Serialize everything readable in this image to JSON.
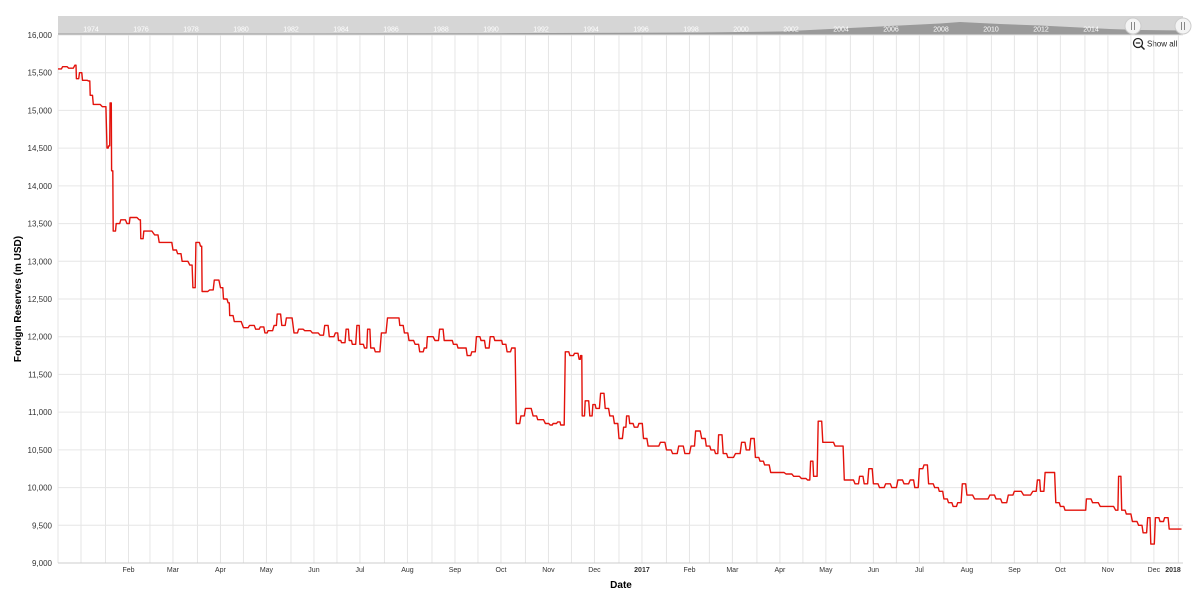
{
  "navigator": {
    "years": [
      "1974",
      "1976",
      "1978",
      "1980",
      "1982",
      "1984",
      "1986",
      "1988",
      "1990",
      "1992",
      "1994",
      "1996",
      "1998",
      "2000",
      "2002",
      "2004",
      "2006",
      "2008",
      "2010",
      "2012",
      "2014"
    ]
  },
  "zoom": {
    "show_all_label": "Show all"
  },
  "colors": {
    "series": "#e3120b",
    "grid": "#e6e6e6",
    "navigator_bg": "#d6d6d6",
    "navigator_area": "#9a9a9a"
  },
  "chart_data": {
    "type": "line",
    "title": "",
    "xlabel": "Date",
    "ylabel": "Foreign Reserves (m USD)",
    "ylim": [
      9000,
      16000
    ],
    "y_ticks": [
      9000,
      9500,
      10000,
      10500,
      11000,
      11500,
      12000,
      12500,
      13000,
      13500,
      14000,
      14500,
      15000,
      15500,
      16000
    ],
    "y_tick_labels": [
      "9,000",
      "9,500",
      "10,000",
      "10,500",
      "11,000",
      "11,500",
      "12,000",
      "12,500",
      "13,000",
      "13,500",
      "14,000",
      "14,500",
      "15,000",
      "15,500",
      "16,000"
    ],
    "xlim": [
      "2016-01-01",
      "2018-01-04"
    ],
    "x_ticks": [
      {
        "date": "2016-02-01",
        "label": "Feb"
      },
      {
        "date": "2016-03-01",
        "label": "Mar"
      },
      {
        "date": "2016-04-01",
        "label": "Apr"
      },
      {
        "date": "2016-05-01",
        "label": "May"
      },
      {
        "date": "2016-06-01",
        "label": "Jun"
      },
      {
        "date": "2016-07-01",
        "label": "Jul"
      },
      {
        "date": "2016-08-01",
        "label": "Aug"
      },
      {
        "date": "2016-09-01",
        "label": "Sep"
      },
      {
        "date": "2016-10-01",
        "label": "Oct"
      },
      {
        "date": "2016-11-01",
        "label": "Nov"
      },
      {
        "date": "2016-12-01",
        "label": "Dec"
      },
      {
        "date": "2017-01-01",
        "label": "2017",
        "bold": true
      },
      {
        "date": "2017-02-01",
        "label": "Feb"
      },
      {
        "date": "2017-03-01",
        "label": "Mar"
      },
      {
        "date": "2017-04-01",
        "label": "Apr"
      },
      {
        "date": "2017-05-01",
        "label": "May"
      },
      {
        "date": "2017-06-01",
        "label": "Jun"
      },
      {
        "date": "2017-07-01",
        "label": "Jul"
      },
      {
        "date": "2017-08-01",
        "label": "Aug"
      },
      {
        "date": "2017-09-01",
        "label": "Sep"
      },
      {
        "date": "2017-10-01",
        "label": "Oct"
      },
      {
        "date": "2017-11-01",
        "label": "Nov"
      },
      {
        "date": "2017-12-01",
        "label": "Dec"
      },
      {
        "date": "2018-01-01",
        "label": "2018",
        "bold": true
      }
    ],
    "series": [
      {
        "points": [
          [
            "2016-01-01",
            15550
          ],
          [
            "2016-01-04",
            15580
          ],
          [
            "2016-01-08",
            15560
          ],
          [
            "2016-01-12",
            15600
          ],
          [
            "2016-01-13",
            15420
          ],
          [
            "2016-01-15",
            15500
          ],
          [
            "2016-01-17",
            15400
          ],
          [
            "2016-01-21",
            15390
          ],
          [
            "2016-01-22",
            15200
          ],
          [
            "2016-01-24",
            15080
          ],
          [
            "2016-01-30",
            15050
          ],
          [
            "2016-02-02",
            14500
          ],
          [
            "2016-02-03",
            14530
          ],
          [
            "2016-02-04",
            15100
          ],
          [
            "2016-02-05",
            14200
          ],
          [
            "2016-02-06",
            13400
          ],
          [
            "2016-02-08",
            13500
          ],
          [
            "2016-02-11",
            13550
          ],
          [
            "2016-02-15",
            13500
          ],
          [
            "2016-02-17",
            13580
          ],
          [
            "2016-02-23",
            13550
          ],
          [
            "2016-02-24",
            13300
          ],
          [
            "2016-02-26",
            13400
          ],
          [
            "2016-03-04",
            13350
          ],
          [
            "2016-03-07",
            13250
          ],
          [
            "2016-03-13",
            13250
          ],
          [
            "2016-03-16",
            13150
          ],
          [
            "2016-03-19",
            13100
          ],
          [
            "2016-03-22",
            13000
          ],
          [
            "2016-03-27",
            12950
          ],
          [
            "2016-03-29",
            12650
          ],
          [
            "2016-03-31",
            13250
          ],
          [
            "2016-04-03",
            13200
          ],
          [
            "2016-04-04",
            12600
          ],
          [
            "2016-04-09",
            12620
          ],
          [
            "2016-04-12",
            12750
          ],
          [
            "2016-04-16",
            12650
          ],
          [
            "2016-04-18",
            12500
          ],
          [
            "2016-04-21",
            12450
          ],
          [
            "2016-04-22",
            12280
          ],
          [
            "2016-04-25",
            12200
          ],
          [
            "2016-05-01",
            12120
          ],
          [
            "2016-05-05",
            12150
          ],
          [
            "2016-05-09",
            12100
          ],
          [
            "2016-05-12",
            12130
          ],
          [
            "2016-05-15",
            12050
          ],
          [
            "2016-05-17",
            12080
          ],
          [
            "2016-05-21",
            12150
          ],
          [
            "2016-05-23",
            12300
          ],
          [
            "2016-05-26",
            12150
          ],
          [
            "2016-05-29",
            12250
          ],
          [
            "2016-06-03",
            12050
          ],
          [
            "2016-06-06",
            12100
          ],
          [
            "2016-06-10",
            12080
          ],
          [
            "2016-06-15",
            12050
          ],
          [
            "2016-06-20",
            12020
          ],
          [
            "2016-06-23",
            12150
          ],
          [
            "2016-06-26",
            12000
          ],
          [
            "2016-06-30",
            12050
          ],
          [
            "2016-07-02",
            11950
          ],
          [
            "2016-07-04",
            11920
          ],
          [
            "2016-07-07",
            12100
          ],
          [
            "2016-07-09",
            11950
          ],
          [
            "2016-07-11",
            11900
          ],
          [
            "2016-07-14",
            12150
          ],
          [
            "2016-07-16",
            11900
          ],
          [
            "2016-07-19",
            11850
          ],
          [
            "2016-07-21",
            12100
          ],
          [
            "2016-07-23",
            11850
          ],
          [
            "2016-07-26",
            11800
          ],
          [
            "2016-07-30",
            12050
          ],
          [
            "2016-08-03",
            12250
          ],
          [
            "2016-08-09",
            12250
          ],
          [
            "2016-08-11",
            12150
          ],
          [
            "2016-08-14",
            12050
          ],
          [
            "2016-08-17",
            11950
          ],
          [
            "2016-08-21",
            11900
          ],
          [
            "2016-08-24",
            11800
          ],
          [
            "2016-08-27",
            11850
          ],
          [
            "2016-08-29",
            12000
          ],
          [
            "2016-09-03",
            11950
          ],
          [
            "2016-09-06",
            12100
          ],
          [
            "2016-09-09",
            11950
          ],
          [
            "2016-09-12",
            11950
          ],
          [
            "2016-09-15",
            11900
          ],
          [
            "2016-09-18",
            11850
          ],
          [
            "2016-09-21",
            11850
          ],
          [
            "2016-09-24",
            11750
          ],
          [
            "2016-09-27",
            11800
          ],
          [
            "2016-09-30",
            12000
          ],
          [
            "2016-10-03",
            11950
          ],
          [
            "2016-10-06",
            11850
          ],
          [
            "2016-10-09",
            12000
          ],
          [
            "2016-10-12",
            11950
          ],
          [
            "2016-10-15",
            11950
          ],
          [
            "2016-10-17",
            11900
          ],
          [
            "2016-10-20",
            11800
          ],
          [
            "2016-10-23",
            11850
          ],
          [
            "2016-10-26",
            10850
          ],
          [
            "2016-10-29",
            10950
          ],
          [
            "2016-11-01",
            11050
          ],
          [
            "2016-11-06",
            10950
          ],
          [
            "2016-11-09",
            10900
          ],
          [
            "2016-11-14",
            10850
          ],
          [
            "2016-11-17",
            10830
          ],
          [
            "2016-11-19",
            10850
          ],
          [
            "2016-11-22",
            10870
          ],
          [
            "2016-11-24",
            10830
          ],
          [
            "2016-11-27",
            11800
          ],
          [
            "2016-11-30",
            11750
          ],
          [
            "2016-12-03",
            11780
          ],
          [
            "2016-12-06",
            11700
          ],
          [
            "2016-12-07",
            11750
          ],
          [
            "2016-12-08",
            10950
          ],
          [
            "2016-12-10",
            11150
          ],
          [
            "2016-12-13",
            10950
          ],
          [
            "2016-12-15",
            11100
          ],
          [
            "2016-12-17",
            11050
          ],
          [
            "2016-12-20",
            11250
          ],
          [
            "2016-12-23",
            11050
          ],
          [
            "2016-12-26",
            10950
          ],
          [
            "2016-12-29",
            10850
          ],
          [
            "2017-01-01",
            10650
          ],
          [
            "2017-01-04",
            10800
          ],
          [
            "2017-01-06",
            10950
          ],
          [
            "2017-01-08",
            10850
          ],
          [
            "2017-01-11",
            10800
          ],
          [
            "2017-01-14",
            10850
          ],
          [
            "2017-01-17",
            10650
          ],
          [
            "2017-01-20",
            10550
          ],
          [
            "2017-01-24",
            10550
          ],
          [
            "2017-01-28",
            10600
          ],
          [
            "2017-02-01",
            10500
          ],
          [
            "2017-02-05",
            10450
          ],
          [
            "2017-02-09",
            10550
          ],
          [
            "2017-02-13",
            10450
          ],
          [
            "2017-02-17",
            10550
          ],
          [
            "2017-02-20",
            10750
          ],
          [
            "2017-02-24",
            10650
          ],
          [
            "2017-02-27",
            10550
          ],
          [
            "2017-03-02",
            10500
          ],
          [
            "2017-03-05",
            10450
          ],
          [
            "2017-03-07",
            10700
          ],
          [
            "2017-03-10",
            10450
          ],
          [
            "2017-03-13",
            10400
          ],
          [
            "2017-03-18",
            10450
          ],
          [
            "2017-03-22",
            10600
          ],
          [
            "2017-03-25",
            10500
          ],
          [
            "2017-03-28",
            10650
          ],
          [
            "2017-03-31",
            10400
          ],
          [
            "2017-04-03",
            10350
          ],
          [
            "2017-04-06",
            10300
          ],
          [
            "2017-04-10",
            10200
          ],
          [
            "2017-04-15",
            10200
          ],
          [
            "2017-04-20",
            10180
          ],
          [
            "2017-04-25",
            10150
          ],
          [
            "2017-04-30",
            10120
          ],
          [
            "2017-05-04",
            10100
          ],
          [
            "2017-05-06",
            10350
          ],
          [
            "2017-05-08",
            10150
          ],
          [
            "2017-05-11",
            10880
          ],
          [
            "2017-05-14",
            10600
          ],
          [
            "2017-05-18",
            10600
          ],
          [
            "2017-05-22",
            10550
          ],
          [
            "2017-05-25",
            10550
          ],
          [
            "2017-05-28",
            10100
          ],
          [
            "2017-05-31",
            10100
          ],
          [
            "2017-06-04",
            10050
          ],
          [
            "2017-06-07",
            10150
          ],
          [
            "2017-06-10",
            10050
          ],
          [
            "2017-06-13",
            10250
          ],
          [
            "2017-06-16",
            10050
          ],
          [
            "2017-06-20",
            10000
          ],
          [
            "2017-06-24",
            10050
          ],
          [
            "2017-06-28",
            10000
          ],
          [
            "2017-07-02",
            10100
          ],
          [
            "2017-07-06",
            10050
          ],
          [
            "2017-07-10",
            10100
          ],
          [
            "2017-07-13",
            10000
          ],
          [
            "2017-07-16",
            10250
          ],
          [
            "2017-07-19",
            10300
          ],
          [
            "2017-07-22",
            10050
          ],
          [
            "2017-07-26",
            10000
          ],
          [
            "2017-07-29",
            9950
          ],
          [
            "2017-08-01",
            9850
          ],
          [
            "2017-08-04",
            9800
          ],
          [
            "2017-08-07",
            9750
          ],
          [
            "2017-08-10",
            9800
          ],
          [
            "2017-08-13",
            10050
          ],
          [
            "2017-08-16",
            9900
          ],
          [
            "2017-08-21",
            9850
          ],
          [
            "2017-08-26",
            9850
          ],
          [
            "2017-08-31",
            9900
          ],
          [
            "2017-09-04",
            9850
          ],
          [
            "2017-09-08",
            9800
          ],
          [
            "2017-09-12",
            9900
          ],
          [
            "2017-09-16",
            9950
          ],
          [
            "2017-09-22",
            9900
          ],
          [
            "2017-09-28",
            9950
          ],
          [
            "2017-10-01",
            10100
          ],
          [
            "2017-10-03",
            9950
          ],
          [
            "2017-10-06",
            10200
          ],
          [
            "2017-10-10",
            10200
          ],
          [
            "2017-10-13",
            9800
          ],
          [
            "2017-10-16",
            9750
          ],
          [
            "2017-10-19",
            9700
          ],
          [
            "2017-10-23",
            9700
          ],
          [
            "2017-10-27",
            9700
          ],
          [
            "2017-10-31",
            9700
          ],
          [
            "2017-11-02",
            9850
          ],
          [
            "2017-11-06",
            9800
          ],
          [
            "2017-11-11",
            9750
          ],
          [
            "2017-11-16",
            9750
          ],
          [
            "2017-11-21",
            9700
          ],
          [
            "2017-11-23",
            10150
          ],
          [
            "2017-11-25",
            9700
          ],
          [
            "2017-11-28",
            9650
          ],
          [
            "2017-12-02",
            9550
          ],
          [
            "2017-12-06",
            9500
          ],
          [
            "2017-12-09",
            9400
          ],
          [
            "2017-12-12",
            9600
          ],
          [
            "2017-12-14",
            9250
          ],
          [
            "2017-12-17",
            9600
          ],
          [
            "2017-12-20",
            9550
          ],
          [
            "2017-12-23",
            9600
          ],
          [
            "2017-12-26",
            9450
          ],
          [
            "2017-12-30",
            9450
          ],
          [
            "2018-01-03",
            9450
          ]
        ]
      }
    ],
    "grid": true,
    "legend": "none"
  }
}
